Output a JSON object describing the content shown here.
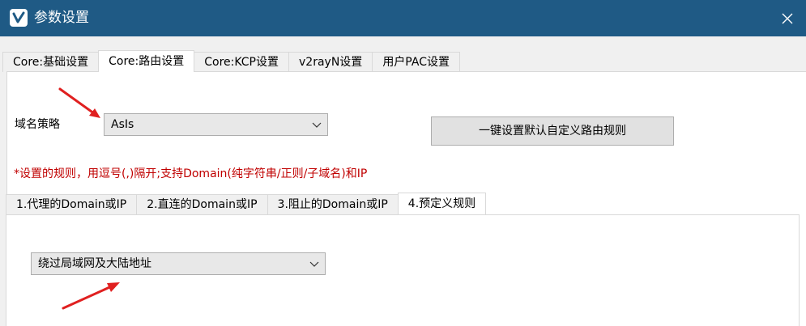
{
  "window": {
    "title": "参数设置",
    "app_icon": "v2rayn-logo-icon",
    "close_icon": "close-icon"
  },
  "tabs": [
    {
      "label": "Core:基础设置",
      "active": false
    },
    {
      "label": "Core:路由设置",
      "active": true
    },
    {
      "label": "Core:KCP设置",
      "active": false
    },
    {
      "label": "v2rayN设置",
      "active": false
    },
    {
      "label": "用户PAC设置",
      "active": false
    }
  ],
  "routing": {
    "domain_strategy_label": "域名策略",
    "domain_strategy_value": "AsIs",
    "reset_button": "一键设置默认自定义路由规则",
    "hint": "*设置的规则，用逗号(,)隔开;支持Domain(纯字符串/正则/子域名)和IP",
    "hint_color": "#c00000",
    "subtabs": [
      {
        "label": "1.代理的Domain或IP",
        "active": false
      },
      {
        "label": "2.直连的Domain或IP",
        "active": false
      },
      {
        "label": "3.阻止的Domain或IP",
        "active": false
      },
      {
        "label": "4.预定义规则",
        "active": true
      }
    ],
    "preset_value": "绕过局域网及大陆地址"
  },
  "colors": {
    "titlebar": "#1f5a85",
    "annotation_arrow": "#e02020"
  }
}
